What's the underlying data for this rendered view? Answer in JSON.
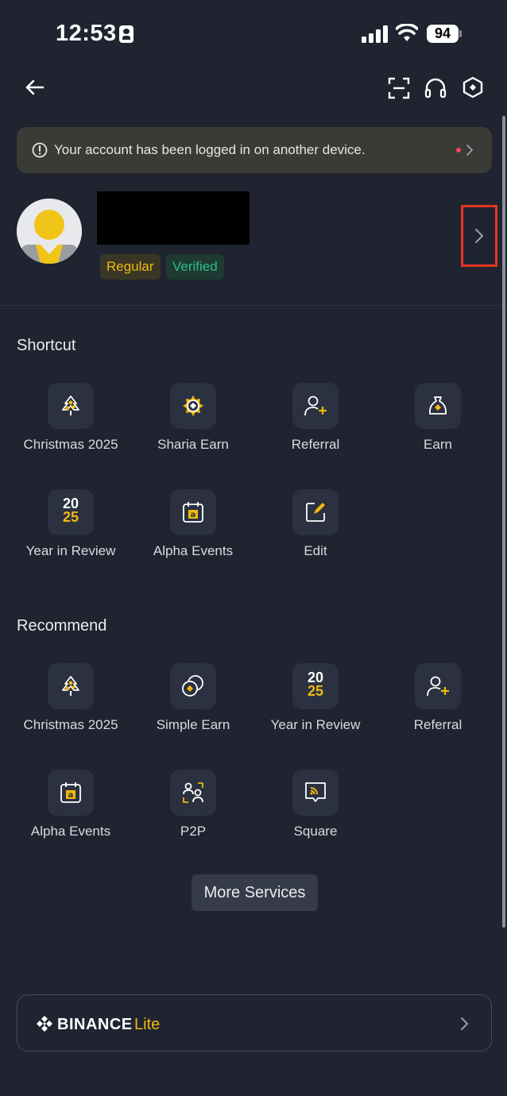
{
  "status_bar": {
    "time": "12:53",
    "battery": "94"
  },
  "notice": {
    "text": "Your account has been logged in on another device."
  },
  "profile": {
    "badges": [
      "Regular",
      "Verified"
    ]
  },
  "shortcut": {
    "title": "Shortcut",
    "items": [
      {
        "label": "Christmas 2025",
        "icon": "christmas-tree-icon"
      },
      {
        "label": "Sharia Earn",
        "icon": "sharia-earn-icon"
      },
      {
        "label": "Referral",
        "icon": "add-user-icon"
      },
      {
        "label": "Earn",
        "icon": "money-bag-icon"
      },
      {
        "label": "Year in Review",
        "icon": "year-2025-icon"
      },
      {
        "label": "Alpha Events",
        "icon": "alpha-calendar-icon"
      },
      {
        "label": "Edit",
        "icon": "edit-icon"
      }
    ]
  },
  "recommend": {
    "title": "Recommend",
    "items": [
      {
        "label": "Christmas 2025",
        "icon": "christmas-tree-icon"
      },
      {
        "label": "Simple Earn",
        "icon": "simple-earn-icon"
      },
      {
        "label": "Year in Review",
        "icon": "year-2025-icon"
      },
      {
        "label": "Referral",
        "icon": "add-user-icon"
      },
      {
        "label": "Alpha Events",
        "icon": "alpha-calendar-icon"
      },
      {
        "label": "P2P",
        "icon": "p2p-icon"
      },
      {
        "label": "Square",
        "icon": "square-icon"
      }
    ]
  },
  "year_icon": {
    "top": "20",
    "bottom": "25"
  },
  "more_services": "More Services",
  "lite": {
    "brand": "BINANCE",
    "sub": "Lite"
  },
  "colors": {
    "accent": "#f0b90b",
    "background": "#1f2430",
    "tile": "#2b3140",
    "verified": "#2ebd85",
    "highlight": "#e53424"
  }
}
